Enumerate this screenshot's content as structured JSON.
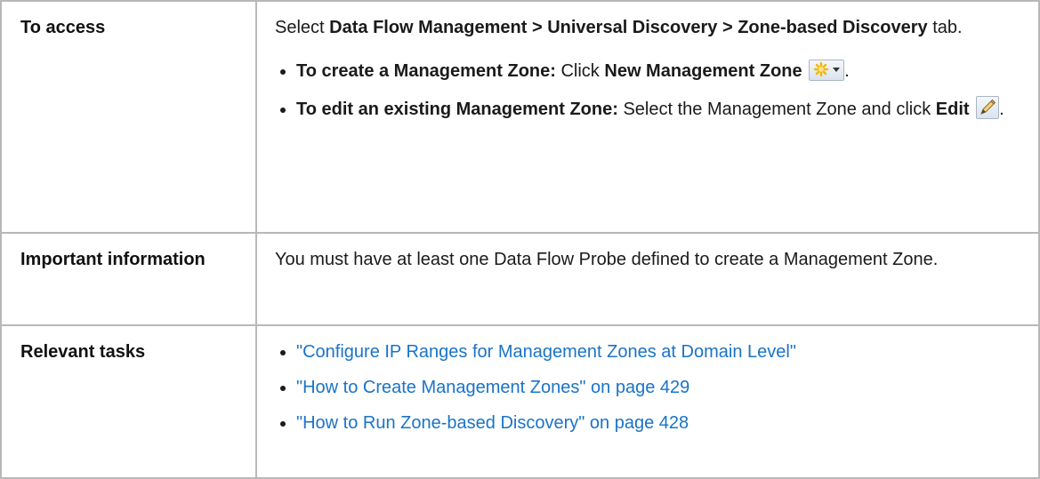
{
  "rows": {
    "access": {
      "label": "To access",
      "intro_prefix": "Select ",
      "intro_bold": "Data Flow Management > Universal Discovery > Zone-based Discovery",
      "intro_suffix": " tab.",
      "items": [
        {
          "lead": "To create a Management Zone:",
          "text1": " Click ",
          "bold2": "New Management Zone",
          "tail": ".",
          "icon": "new-star-dropdown-icon"
        },
        {
          "lead": "To edit an existing Management Zone:",
          "text1": " Select the Management Zone and click ",
          "bold2": "Edit",
          "tail": ".",
          "icon": "pencil-edit-icon"
        }
      ]
    },
    "important": {
      "label": "Important information",
      "text": "You must have at least one Data Flow Probe defined to create a Management Zone."
    },
    "tasks": {
      "label": "Relevant tasks",
      "links": [
        "\"Configure IP Ranges for Management Zones at Domain Level\"",
        "\"How to Create Management Zones\" on page 429",
        "\"How to Run Zone-based Discovery\" on page 428"
      ]
    }
  },
  "colors": {
    "link": "#1a73c8",
    "border": "#b8b8b8",
    "text": "#1a1a1a"
  }
}
